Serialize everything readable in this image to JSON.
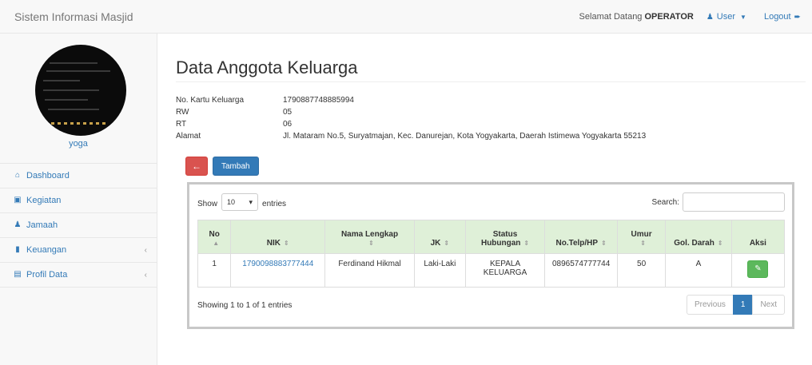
{
  "app": {
    "brand": "Sistem Informasi Masjid"
  },
  "navbar": {
    "welcome_prefix": "Selamat Datang",
    "welcome_user": "OPERATOR",
    "user_menu": "User",
    "logout": "Logout"
  },
  "sidebar": {
    "username": "yoga",
    "items": [
      {
        "label": "Dashboard",
        "icon": "home-icon"
      },
      {
        "label": "Kegiatan",
        "icon": "calendar-icon"
      },
      {
        "label": "Jamaah",
        "icon": "users-icon"
      },
      {
        "label": "Keuangan",
        "icon": "book-icon",
        "has_submenu": true
      },
      {
        "label": "Profil Data",
        "icon": "file-icon",
        "has_submenu": true
      }
    ]
  },
  "page": {
    "title": "Data Anggota Keluarga",
    "info": [
      {
        "label": "No. Kartu Keluarga",
        "value": "1790887748885994"
      },
      {
        "label": "RW",
        "value": "05"
      },
      {
        "label": "RT",
        "value": "06"
      },
      {
        "label": "Alamat",
        "value": "Jl. Mataram No.5, Suryatmajan, Kec. Danurejan, Kota Yogyakarta, Daerah Istimewa Yogyakarta 55213"
      }
    ],
    "back_icon": "←",
    "add_button": "Tambah"
  },
  "table": {
    "show_label": "Show",
    "entries_value": "10",
    "entries_label": "entries",
    "search_label": "Search:",
    "search_value": "",
    "columns": [
      "No",
      "NIK",
      "Nama Lengkap",
      "JK",
      "Status Hubungan",
      "No.Telp/HP",
      "Umur",
      "Gol. Darah",
      "Aksi"
    ],
    "rows": [
      {
        "no": "1",
        "nik": "1790098883777444",
        "nama": "Ferdinand Hikmal",
        "jk": "Laki-Laki",
        "status": "KEPALA KELUARGA",
        "telp": "0896574777744",
        "umur": "50",
        "gol": "A"
      }
    ],
    "info_text": "Showing 1 to 1 of 1 entries",
    "pagination": {
      "previous": "Previous",
      "current": "1",
      "next": "Next"
    }
  },
  "colors": {
    "primary": "#337ab7",
    "danger": "#d9534f",
    "success": "#5cb85c",
    "header_bg": "#dff0d8"
  }
}
